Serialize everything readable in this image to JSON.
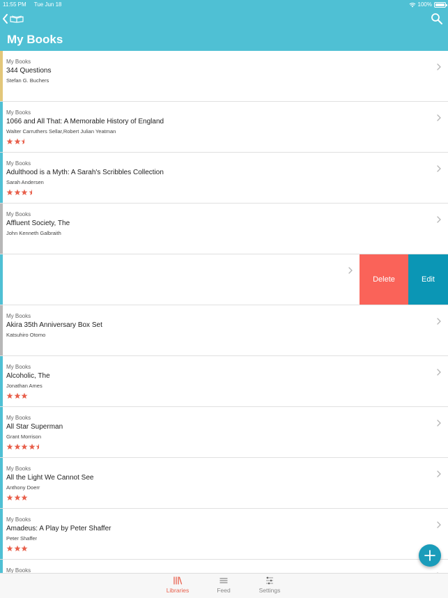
{
  "status": {
    "time": "11:55 PM",
    "date": "Tue Jun 18",
    "battery": "100%"
  },
  "header": {
    "title": "My Books"
  },
  "colors": {
    "header": "#4fc0d4",
    "star": "#e8604c",
    "delete": "#fa6359",
    "edit": "#0b96b5",
    "active_tab": "#e8604c"
  },
  "books": [
    {
      "library": "My Books",
      "title": "344 Questions",
      "author": "Stefan G. Buchers",
      "rating": 0,
      "stripe": "#e3c77a"
    },
    {
      "library": "My Books",
      "title": "1066 and All That: A Memorable History of England",
      "author": "Walter Carruthers Sellar,Robert Julian Yeatman",
      "rating": 2.5,
      "stripe": "#4fc0d4"
    },
    {
      "library": "My Books",
      "title": "Adulthood is a Myth: A Sarah's Scribbles Collection",
      "author": "Sarah Andersen",
      "rating": 3.5,
      "stripe": "#4fc0d4"
    },
    {
      "library": "My Books",
      "title": "Affluent Society, The",
      "author": "John Kenneth Galbraith",
      "rating": 0,
      "stripe": "#b7b7b7"
    }
  ],
  "swiped_row": {
    "delete_label": "Delete",
    "edit_label": "Edit",
    "stripe": "#4fc0d4"
  },
  "books_after": [
    {
      "library": "My Books",
      "title": "Akira 35th Anniversary Box Set",
      "author": "Katsuhiro Otomo",
      "rating": 0,
      "stripe": "#b7b7b7"
    },
    {
      "library": "My Books",
      "title": "Alcoholic, The",
      "author": "Jonathan Ames",
      "rating": 3,
      "stripe": "#4fc0d4"
    },
    {
      "library": "My Books",
      "title": "All Star Superman",
      "author": "Grant Morrison",
      "rating": 4.5,
      "stripe": "#4fc0d4"
    },
    {
      "library": "My Books",
      "title": "All the Light We Cannot See",
      "author": "Anthony Doerr",
      "rating": 3,
      "stripe": "#4fc0d4"
    },
    {
      "library": "My Books",
      "title": "Amadeus: A Play by Peter Shaffer",
      "author": "Peter Shaffer",
      "rating": 3,
      "stripe": "#4fc0d4"
    },
    {
      "library": "My Books",
      "title": "",
      "author": "",
      "rating": 0,
      "stripe": "#4fc0d4"
    }
  ],
  "tabs": [
    {
      "label": "Libraries",
      "icon": "libraries-icon",
      "active": true
    },
    {
      "label": "Feed",
      "icon": "feed-icon",
      "active": false
    },
    {
      "label": "Settings",
      "icon": "settings-sliders-icon",
      "active": false
    }
  ],
  "fab": {
    "icon": "plus-icon"
  }
}
